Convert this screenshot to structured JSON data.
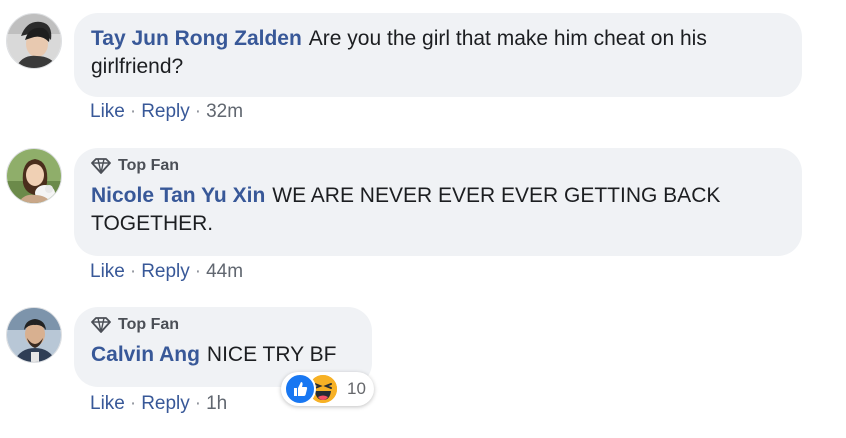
{
  "comments": [
    {
      "author": "Tay Jun Rong Zalden",
      "text": "Are you the girl that make him cheat on his girlfriend?",
      "top_fan": false,
      "like_label": "Like",
      "reply_label": "Reply",
      "time": "32m"
    },
    {
      "author": "Nicole Tan Yu Xin",
      "text": "WE ARE NEVER EVER EVER GETTING BACK TOGETHER.",
      "top_fan": true,
      "badge_label": "Top Fan",
      "like_label": "Like",
      "reply_label": "Reply",
      "time": "44m"
    },
    {
      "author": "Calvin Ang",
      "text": "NICE TRY BF",
      "top_fan": true,
      "badge_label": "Top Fan",
      "like_label": "Like",
      "reply_label": "Reply",
      "time": "1h",
      "reactions": {
        "icons": [
          "like-icon",
          "haha-icon"
        ],
        "count": "10"
      }
    }
  ],
  "separator": "·",
  "colors": {
    "author_link": "#385898",
    "bubble_bg": "#f0f2f5",
    "like_blue": "#1877f2",
    "haha_yellow": "#f7b125"
  }
}
